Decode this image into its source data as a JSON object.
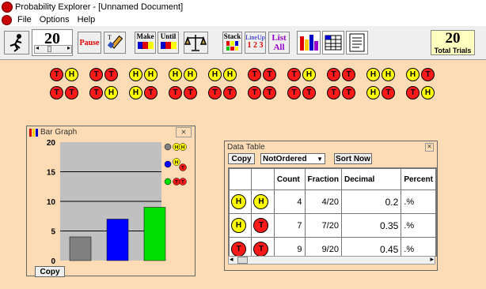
{
  "window": {
    "title": "Probability Explorer - [Unnamed Document]"
  },
  "menu": [
    "File",
    "Options",
    "Help"
  ],
  "toolbar": {
    "count_value": "20",
    "pause_label": "Pause",
    "make_until": [
      "Make",
      "Until"
    ],
    "stack_label": "Stack",
    "lineup_label": "LineUp",
    "lineup_nums": "1 2 3",
    "list_label": "List",
    "all_label": "All",
    "total_value": "20",
    "total_label": "Total Trials"
  },
  "trials": [
    [
      "T",
      "H"
    ],
    [
      "T",
      "T"
    ],
    [
      "H",
      "H"
    ],
    [
      "H",
      "H"
    ],
    [
      "H",
      "H"
    ],
    [
      "T",
      "T"
    ],
    [
      "T",
      "H"
    ],
    [
      "T",
      "T"
    ],
    [
      "H",
      "H"
    ],
    [
      "H",
      "T"
    ],
    [
      "T",
      "T"
    ],
    [
      "T",
      "H"
    ],
    [
      "H",
      "T"
    ],
    [
      "T",
      "T"
    ],
    [
      "T",
      "T"
    ],
    [
      "T",
      "T"
    ],
    [
      "T",
      "T"
    ],
    [
      "T",
      "T"
    ],
    [
      "H",
      "T"
    ],
    [
      "T",
      "H"
    ]
  ],
  "bar_graph": {
    "title": "Bar Graph",
    "copy_label": "Copy",
    "legend_icons": [
      "gray-dot",
      "blue-dot",
      "green-dot"
    ],
    "colors": [
      "#808080",
      "#0000ff",
      "#00e000"
    ]
  },
  "chart_data": {
    "type": "bar",
    "title": "Bar Graph",
    "categories": [
      "HH",
      "HT",
      "TT"
    ],
    "values": [
      4,
      7,
      9
    ],
    "ylim": [
      0,
      20
    ],
    "yticks": [
      0,
      5,
      10,
      15,
      20
    ],
    "grid": true,
    "legend": "right",
    "xlabel": "",
    "ylabel": ""
  },
  "data_table": {
    "title": "Data Table",
    "copy_label": "Copy",
    "order_value": "NotOrdered",
    "sort_label": "Sort Now",
    "headers": [
      "Count",
      "Fraction",
      "Decimal",
      "Percent"
    ],
    "rows": [
      {
        "c1": "H",
        "c2": "H",
        "count": "4",
        "fraction": "4/20",
        "decimal": "0.2",
        "percent": ".%"
      },
      {
        "c1": "H",
        "c2": "T",
        "count": "7",
        "fraction": "7/20",
        "decimal": "0.35",
        "percent": ".%"
      },
      {
        "c1": "T",
        "c2": "T",
        "count": "9",
        "fraction": "9/20",
        "decimal": "0.45",
        "percent": ".%"
      }
    ]
  }
}
